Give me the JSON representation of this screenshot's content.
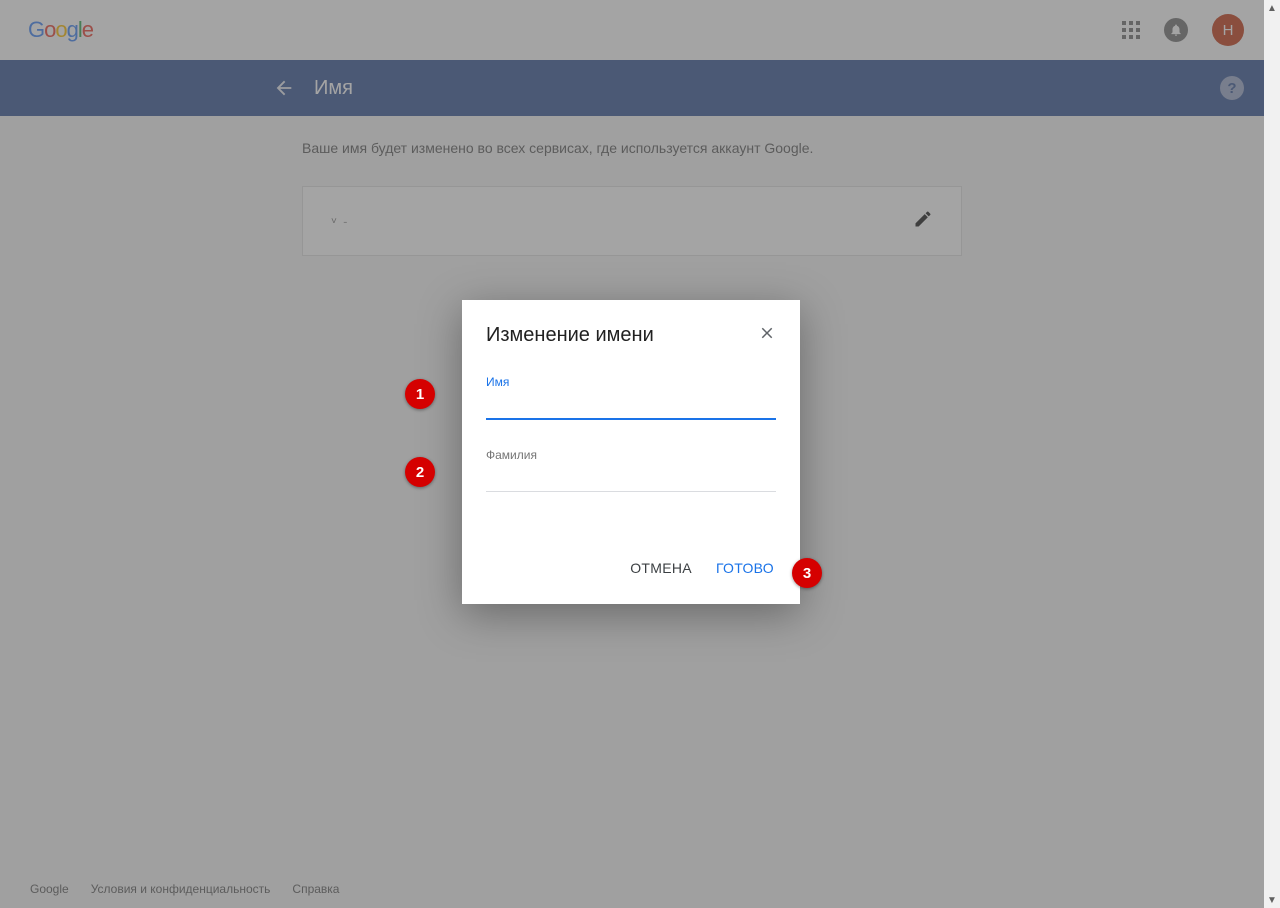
{
  "header": {
    "avatar_initial": "Н",
    "logo_letters": [
      "G",
      "o",
      "o",
      "g",
      "l",
      "e"
    ]
  },
  "bluebar": {
    "title": "Имя"
  },
  "main": {
    "description": "Ваше имя будет изменено во всех сервисах, где используется аккаунт Google.",
    "card_text": "˅  ˗"
  },
  "modal": {
    "title": "Изменение имени",
    "first_name_label": "Имя",
    "first_name_value": "",
    "last_name_label": "Фамилия",
    "last_name_value": "",
    "cancel": "ОТМЕНА",
    "done": "ГОТОВО"
  },
  "footer": {
    "google": "Google",
    "privacy": "Условия и конфиденциальность",
    "help": "Справка"
  },
  "annotations": {
    "b1": "1",
    "b2": "2",
    "b3": "3"
  }
}
